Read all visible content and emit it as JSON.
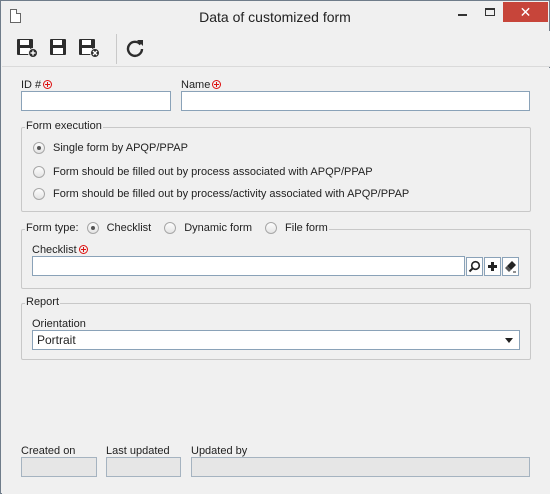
{
  "window": {
    "title": "Data of customized form"
  },
  "toolbar": {
    "buttons": [
      {
        "name": "save-new-icon"
      },
      {
        "name": "save-icon"
      },
      {
        "name": "save-close-icon"
      },
      {
        "name": "refresh-icon"
      }
    ]
  },
  "fields": {
    "id_label": "ID #",
    "id_value": "",
    "name_label": "Name",
    "name_value": ""
  },
  "form_execution": {
    "legend": "Form execution",
    "options": [
      {
        "label": "Single form by APQP/PPAP",
        "selected": true
      },
      {
        "label": "Form should be filled out by process associated with APQP/PPAP",
        "selected": false
      },
      {
        "label": "Form should be filled out by process/activity associated with APQP/PPAP",
        "selected": false
      }
    ]
  },
  "form_type": {
    "legend": "Form type:",
    "options": [
      {
        "label": "Checklist",
        "selected": true
      },
      {
        "label": "Dynamic form",
        "selected": false
      },
      {
        "label": "File form",
        "selected": false
      }
    ],
    "checklist_label": "Checklist",
    "checklist_value": ""
  },
  "report": {
    "legend": "Report",
    "orientation_label": "Orientation",
    "orientation_value": "Portrait"
  },
  "footer": {
    "created_on_label": "Created on",
    "created_on_value": "",
    "last_updated_label": "Last updated",
    "last_updated_value": "",
    "updated_by_label": "Updated by",
    "updated_by_value": ""
  },
  "colors": {
    "close_button": "#c7453a",
    "required_marker": "#dd1111",
    "input_border": "#8aa2b8"
  }
}
